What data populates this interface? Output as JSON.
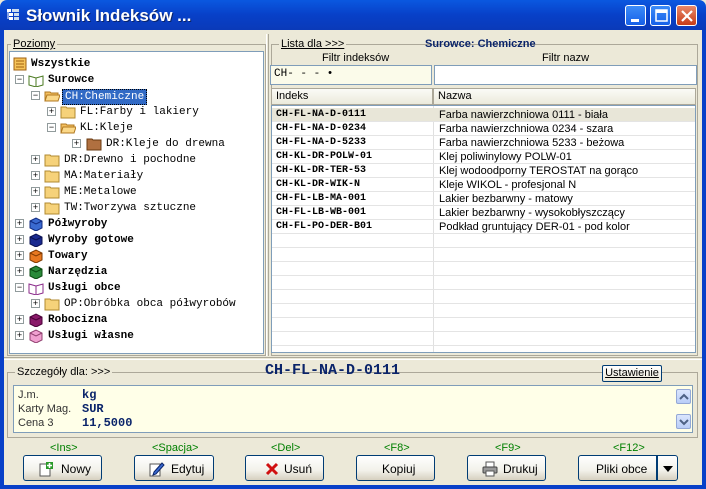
{
  "window": {
    "title": "Słownik Indeksów ..."
  },
  "tree": {
    "group_label": "Poziomy",
    "nodes": [
      {
        "label": "Wszystkie",
        "bold": true
      },
      {
        "label": "Surowce",
        "bold": true
      },
      {
        "label": "CH:Chemiczne",
        "selected": true
      },
      {
        "label": "FL:Farby i lakiery"
      },
      {
        "label": "KL:Kleje"
      },
      {
        "label": "DR:Kleje do drewna"
      },
      {
        "label": "DR:Drewno i pochodne"
      },
      {
        "label": "MA:Materiały"
      },
      {
        "label": "ME:Metalowe"
      },
      {
        "label": "TW:Tworzywa sztuczne"
      },
      {
        "label": "Półwyroby",
        "bold": true
      },
      {
        "label": "Wyroby gotowe",
        "bold": true
      },
      {
        "label": "Towary",
        "bold": true
      },
      {
        "label": "Narzędzia",
        "bold": true
      },
      {
        "label": "Usługi obce",
        "bold": true
      },
      {
        "label": "OP:Obróbka obca półwyrobów"
      },
      {
        "label": "Robocizna",
        "bold": true
      },
      {
        "label": "Usługi własne",
        "bold": true
      }
    ]
  },
  "list": {
    "group_label": "Lista dla >>>",
    "context_title": "Surowce: Chemiczne",
    "filter_index_label": "Filtr indeksów",
    "filter_name_label": "Filtr nazw",
    "filter_index_value": "CH-  -  -         •",
    "filter_name_value": "",
    "columns": [
      "Indeks",
      "Nazwa"
    ],
    "rows": [
      {
        "index": "CH-FL-NA-D-0111",
        "name": "Farba nawierzchniowa 0111 - biała"
      },
      {
        "index": "CH-FL-NA-D-0234",
        "name": "Farba nawierzchniowa 0234 - szara"
      },
      {
        "index": "CH-FL-NA-D-5233",
        "name": "Farba nawierzchniowa 5233 - beżowa"
      },
      {
        "index": "CH-KL-DR-POLW-01",
        "name": "Klej poliwinylowy POLW-01"
      },
      {
        "index": "CH-KL-DR-TER-53",
        "name": "Klej wodoodporny TEROSTAT na gorąco"
      },
      {
        "index": "CH-KL-DR-WIK-N",
        "name": "Kleje WIKOL - profesjonal N"
      },
      {
        "index": "CH-FL-LB-MA-001",
        "name": "Lakier bezbarwny - matowy"
      },
      {
        "index": "CH-FL-LB-WB-001",
        "name": "Lakier bezbarwny - wysokobłyszczący"
      },
      {
        "index": "CH-FL-PO-DER-B01",
        "name": "Podkład gruntujący DER-01 - pod kolor"
      }
    ]
  },
  "details": {
    "group_label": "Szczegóły dla: >>>",
    "code": "CH-FL-NA-D-0111",
    "settings_button": "Ustawienie",
    "fields": [
      {
        "key": "J.m.",
        "value": "kg"
      },
      {
        "key": "Karty Mag.",
        "value": "SUR"
      },
      {
        "key": "Cena 3",
        "value": "11,5000"
      }
    ]
  },
  "toolbar": {
    "buttons": [
      {
        "key": "<Ins>",
        "label": "Nowy",
        "icon": "new-icon"
      },
      {
        "key": "<Spacja>",
        "label": "Edytuj",
        "icon": "edit-icon"
      },
      {
        "key": "<Del>",
        "label": "Usuń",
        "icon": "delete-icon"
      },
      {
        "key": "<F8>",
        "label": "Kopiuj",
        "icon": ""
      },
      {
        "key": "<F9>",
        "label": "Drukuj",
        "icon": "printer-icon"
      },
      {
        "key": "<F12>",
        "label": "Pliki obce",
        "icon": "dropdown-arrow-icon"
      }
    ]
  },
  "colors": {
    "title_bar": "#0840c8",
    "selection": "#316ac5",
    "accent_text": "#0a246a",
    "shortcut_text": "#008000"
  }
}
